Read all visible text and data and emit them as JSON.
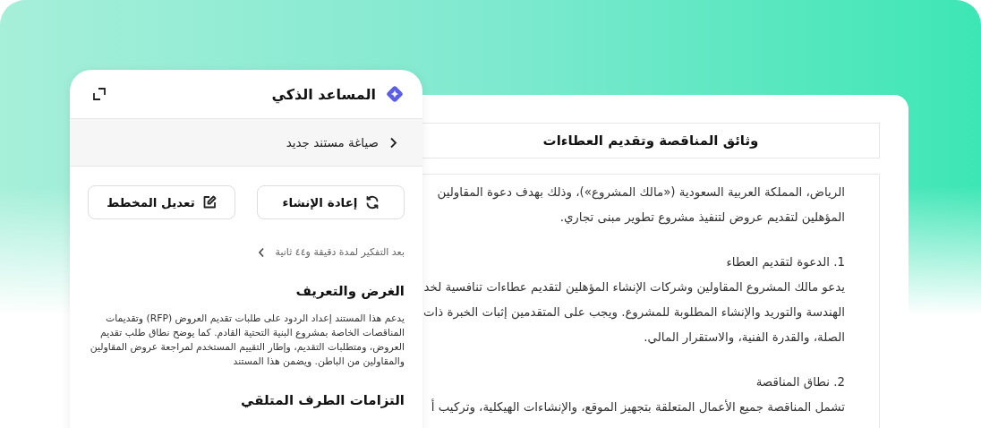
{
  "assistant": {
    "title": "المساعد الذكي",
    "breadcrumb": "صياغة مستند جديد",
    "buttons": [
      {
        "label": "إعادة الإنشاء",
        "kind": "regenerate"
      },
      {
        "label": "تعديل المخطط",
        "kind": "edit"
      }
    ],
    "thinking": "بعد التفكير لمدة دقيقة و٤٤ ثانية",
    "sections": [
      {
        "heading": "الغرض والتعريف",
        "body": "يدعم هذا المستند إعداد الردود على طلبات تقديم العروض (RFP) وتقديمات المناقصات الخاصة بمشروع البنية التحتية القادم. كما يوضح نطاق طلب تقديم العروض، ومتطلبات التقديم، وإطار التقييم المستخدم لمراجعة عروض المقاولين والمقاولين من الباطن. ويضمن هذا المستند"
      },
      {
        "heading": "التزامات الطرف المتلقي"
      }
    ]
  },
  "document": {
    "title": "وثائق المناقصة وتقديم العطاءات",
    "paragraphs": [
      {
        "lines": [
          "الرياض، المملكة العربية السعودية («مالك المشروع»)، وذلك بهدف دعوة المقاولين",
          "المؤهلين لتقديم عروض لتنفيذ مشروع تطوير مبنى تجاري."
        ]
      },
      {
        "heading": "1. الدعوة لتقديم العطاء",
        "lines": [
          "يدعو مالك المشروع المقاولين وشركات الإنشاء المؤهلين لتقديم عطاءات تنافسية لخد",
          "الهندسة والتوريد والإنشاء المطلوبة للمشروع. ويجب على المتقدمين إثبات الخبرة ذات",
          "الصلة، والقدرة الفنية، والاستقرار المالي."
        ]
      },
      {
        "heading": "2. نطاق المناقصة",
        "lines": [
          "تشمل المناقصة جميع الأعمال المتعلقة بتجهيز الموقع، والإنشاءات الهيكلية، وتركيب أ"
        ]
      }
    ]
  }
}
